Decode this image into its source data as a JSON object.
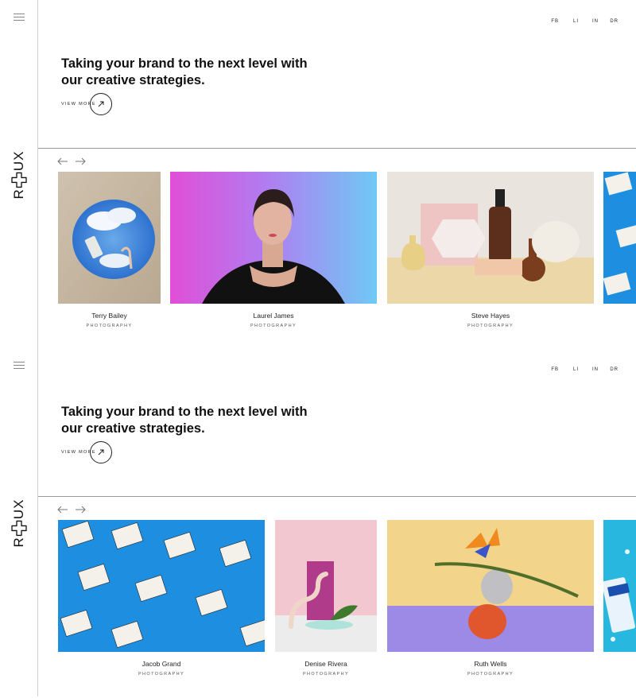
{
  "brand": {
    "logo_left": "R",
    "logo_right": "UX",
    "accent": "#111111"
  },
  "social": [
    "FB",
    "LI",
    "IN",
    "DR"
  ],
  "hero": {
    "title": "Taking your brand to the next level with our creative strategies.",
    "view_more": "VIEW MORE"
  },
  "panels": [
    {
      "cards": [
        {
          "name": "Terry Bailey",
          "role": "PHOTOGRAPHY",
          "image": "sand-mirror-sky"
        },
        {
          "name": "Laurel James",
          "role": "PHOTOGRAPHY",
          "image": "woman-neon-portrait"
        },
        {
          "name": "Steve Hayes",
          "role": "PHOTOGRAPHY",
          "image": "bottles-still-life"
        },
        {
          "name": "",
          "role": "",
          "image": "boxed-water-partial"
        }
      ]
    },
    {
      "cards": [
        {
          "name": "Jacob Grand",
          "role": "PHOTOGRAPHY",
          "image": "boxed-water-cartons"
        },
        {
          "name": "Denise Rivera",
          "role": "PHOTOGRAPHY",
          "image": "pink-sculpture"
        },
        {
          "name": "Ruth Wells",
          "role": "PHOTOGRAPHY",
          "image": "bird-of-paradise"
        },
        {
          "name": "",
          "role": "",
          "image": "blue-product-partial"
        }
      ]
    }
  ]
}
